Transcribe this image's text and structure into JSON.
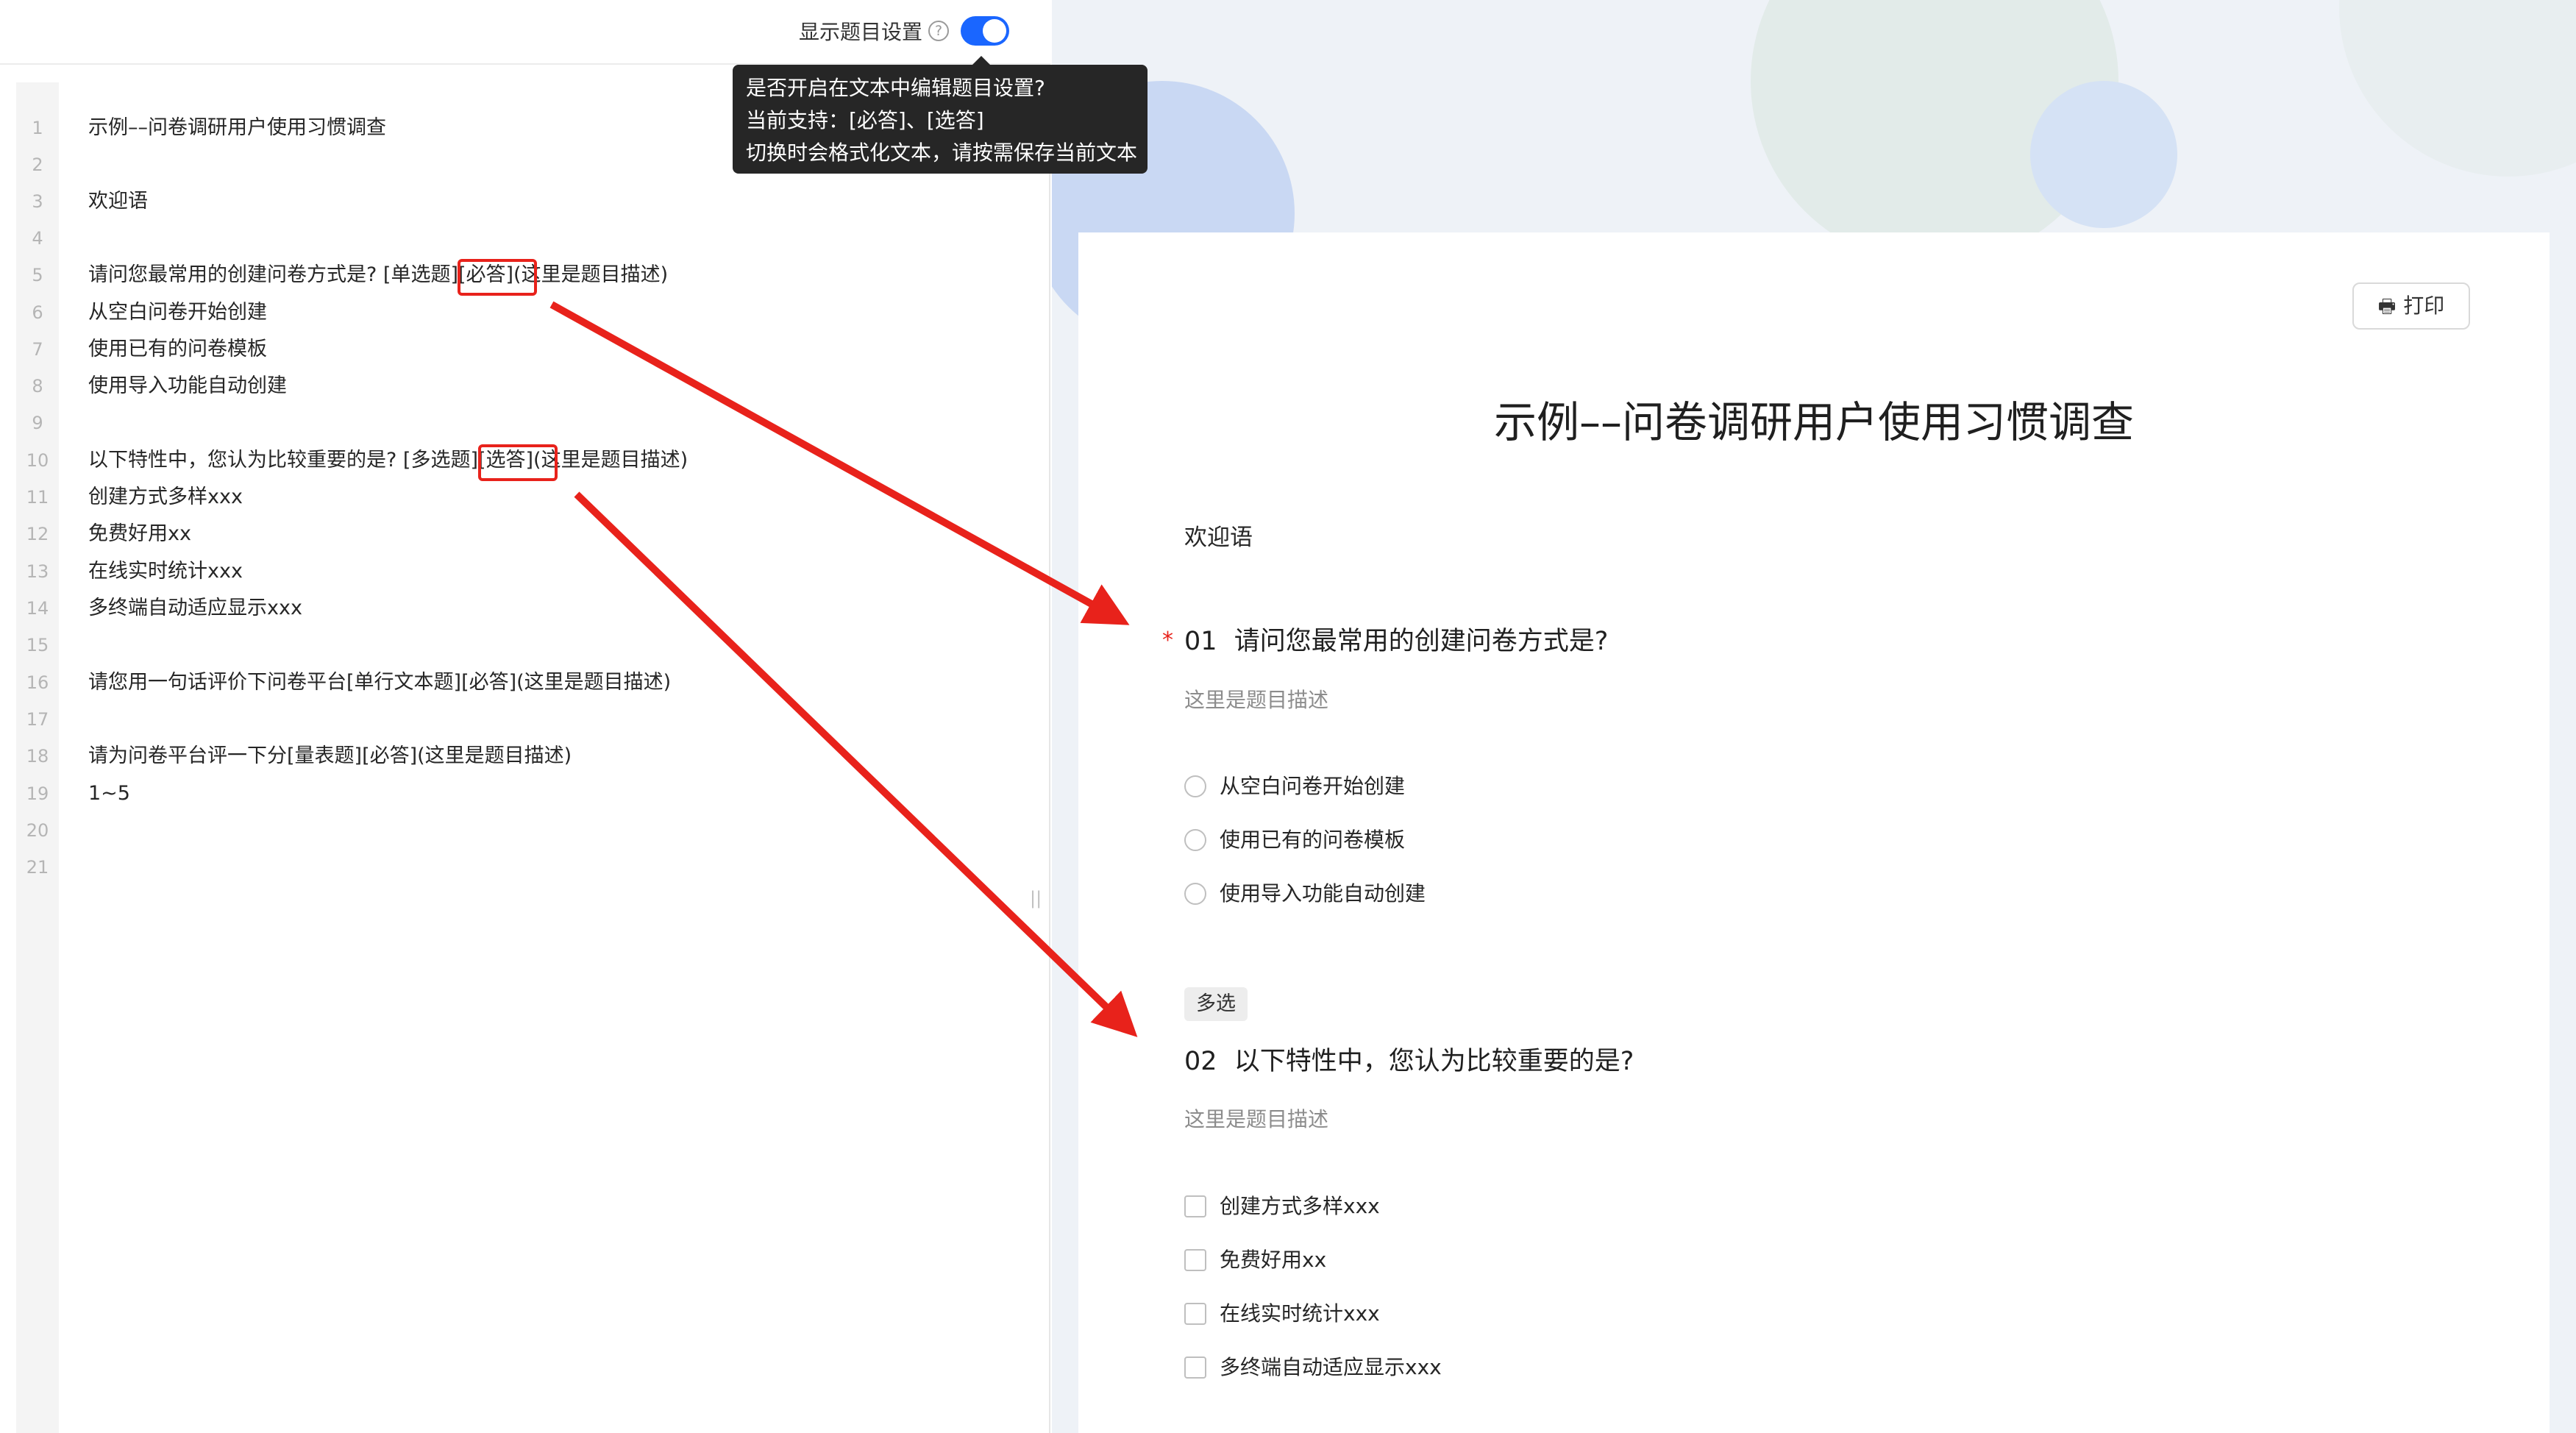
{
  "editor": {
    "toggle_label": "显示题目设置",
    "toggle_on": true,
    "tooltip": {
      "line1": "是否开启在文本中编辑题目设置?",
      "line2": "当前支持：[必答]、[选答]",
      "line3": "切换时会格式化文本，请按需保存当前文本"
    },
    "lines": [
      {
        "num": "1",
        "text": "示例––问卷调研用户使用习惯调查"
      },
      {
        "num": "2",
        "text": ""
      },
      {
        "num": "3",
        "text": "欢迎语"
      },
      {
        "num": "4",
        "text": ""
      },
      {
        "num": "5",
        "text": "请问您最常用的创建问卷方式是? [单选题][必答](这里是题目描述)"
      },
      {
        "num": "6",
        "text": "从空白问卷开始创建"
      },
      {
        "num": "7",
        "text": "使用已有的问卷模板"
      },
      {
        "num": "8",
        "text": "使用导入功能自动创建"
      },
      {
        "num": "9",
        "text": ""
      },
      {
        "num": "10",
        "text": "以下特性中，您认为比较重要的是? [多选题][选答](这里是题目描述)"
      },
      {
        "num": "11",
        "text": "创建方式多样xxx"
      },
      {
        "num": "12",
        "text": "免费好用xx"
      },
      {
        "num": "13",
        "text": "在线实时统计xxx"
      },
      {
        "num": "14",
        "text": "多终端自动适应显示xxx"
      },
      {
        "num": "15",
        "text": ""
      },
      {
        "num": "16",
        "text": "请您用一句话评价下问卷平台[单行文本题][必答](这里是题目描述)"
      },
      {
        "num": "17",
        "text": ""
      },
      {
        "num": "18",
        "text": "请为问卷平台评一下分[量表题][必答](这里是题目描述)"
      },
      {
        "num": "19",
        "text": "1~5"
      },
      {
        "num": "20",
        "text": ""
      },
      {
        "num": "21",
        "text": ""
      }
    ]
  },
  "preview": {
    "print_label": "打印",
    "print_icon": "printer-icon",
    "title": "示例––问卷调研用户使用习惯调查",
    "welcome": "欢迎语",
    "questions": [
      {
        "number": "01",
        "required": true,
        "required_mark": "*",
        "title": "请问您最常用的创建问卷方式是?",
        "description": "这里是题目描述",
        "type": "radio",
        "options": [
          "从空白问卷开始创建",
          "使用已有的问卷模板",
          "使用导入功能自动创建"
        ]
      },
      {
        "number": "02",
        "required": false,
        "type_tag": "多选",
        "title": "以下特性中，您认为比较重要的是?",
        "description": "这里是题目描述",
        "type": "checkbox",
        "options": [
          "创建方式多样xxx",
          "免费好用xx",
          "在线实时统计xxx",
          "多终端自动适应显示xxx"
        ]
      }
    ]
  },
  "colors": {
    "accent": "#1a66ff",
    "annotation_red": "#e8221b",
    "required_star": "#e8221b",
    "tooltip_bg": "#262626"
  }
}
